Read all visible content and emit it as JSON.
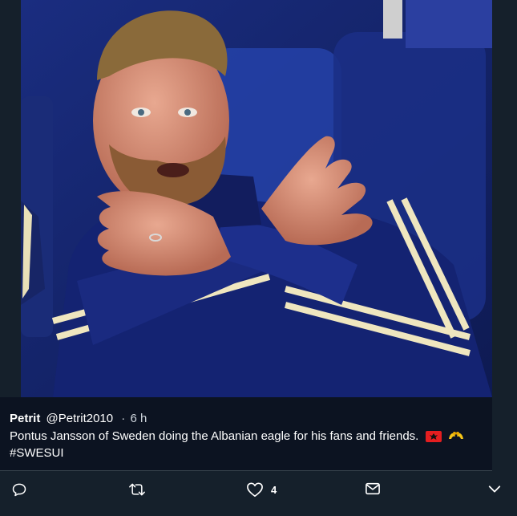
{
  "tweet": {
    "display_name": "Petrit",
    "handle": "@Petrit2010",
    "separator": "·",
    "time": "6 h",
    "text": "Pontus Jansson of Sweden doing the Albanian eagle for his fans and friends.",
    "emojis": [
      "flag-albania-icon",
      "flexed-arms-icon"
    ],
    "hashtag": "#SWESUI"
  },
  "media": {
    "description_icon": "photo-of-player-making-eagle-gesture"
  },
  "actions": {
    "reply_icon": "reply-icon",
    "retweet_icon": "retweet-icon",
    "like_icon": "heart-icon",
    "like_count": "4",
    "message_icon": "envelope-icon",
    "more_icon": "chevron-down-icon"
  },
  "colors": {
    "background": "#15202b",
    "albania_red": "#e41e20",
    "accent_gold": "#f5c518"
  }
}
